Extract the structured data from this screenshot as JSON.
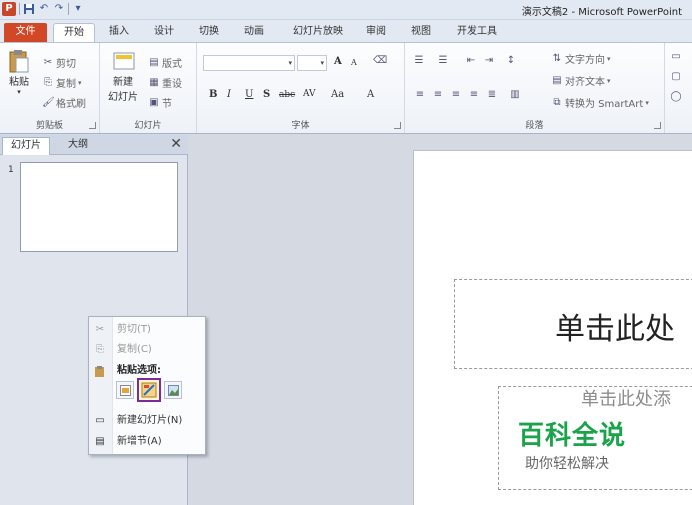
{
  "window": {
    "title": "演示文稿2 - Microsoft PowerPoint",
    "app_icon": "P"
  },
  "quick_access": {
    "icons": [
      "save-icon",
      "undo-icon",
      "redo-icon",
      "customize-icon"
    ]
  },
  "ribbon_tabs": {
    "file": "文件",
    "home": "开始",
    "insert": "插入",
    "design": "设计",
    "transitions": "切换",
    "animations": "动画",
    "slideshow": "幻灯片放映",
    "review": "审阅",
    "view": "视图",
    "developer": "开发工具"
  },
  "ribbon": {
    "clipboard": {
      "label": "剪贴板",
      "paste": "粘贴",
      "cut": "剪切",
      "copy": "复制",
      "format_painter": "格式刷"
    },
    "slides": {
      "label": "幻灯片",
      "new_slide_top": "新建",
      "new_slide_bottom": "幻灯片",
      "layout": "版式",
      "reset": "重设",
      "section": "节"
    },
    "font": {
      "label": "字体",
      "bold": "B",
      "italic": "I",
      "underline": "U",
      "shadow": "S",
      "strike": "abc",
      "spacing": "AV",
      "case": "Aa",
      "color": "A",
      "grow": "A",
      "shrink": "A"
    },
    "paragraph": {
      "label": "段落",
      "text_direction": "文字方向",
      "align_text": "对齐文本",
      "smartart": "转换为 SmartArt"
    }
  },
  "left_panel": {
    "tab_slides": "幻灯片",
    "tab_outline": "大纲",
    "close": "✕",
    "slide_number": "1"
  },
  "context_menu": {
    "cut": "剪切(T)",
    "copy": "复制(C)",
    "paste_options": "粘贴选项:",
    "new_slide": "新建幻灯片(N)",
    "new_section": "新增节(A)"
  },
  "slide": {
    "title_placeholder": "单击此处",
    "subtitle_placeholder": "单击此处添"
  },
  "watermark": {
    "brand": "百科全说",
    "tagline": "助你轻松解决"
  },
  "colors": {
    "file_tab": "#d24726",
    "selection_border": "#7d2a9b",
    "watermark_green": "#1aa34a"
  }
}
